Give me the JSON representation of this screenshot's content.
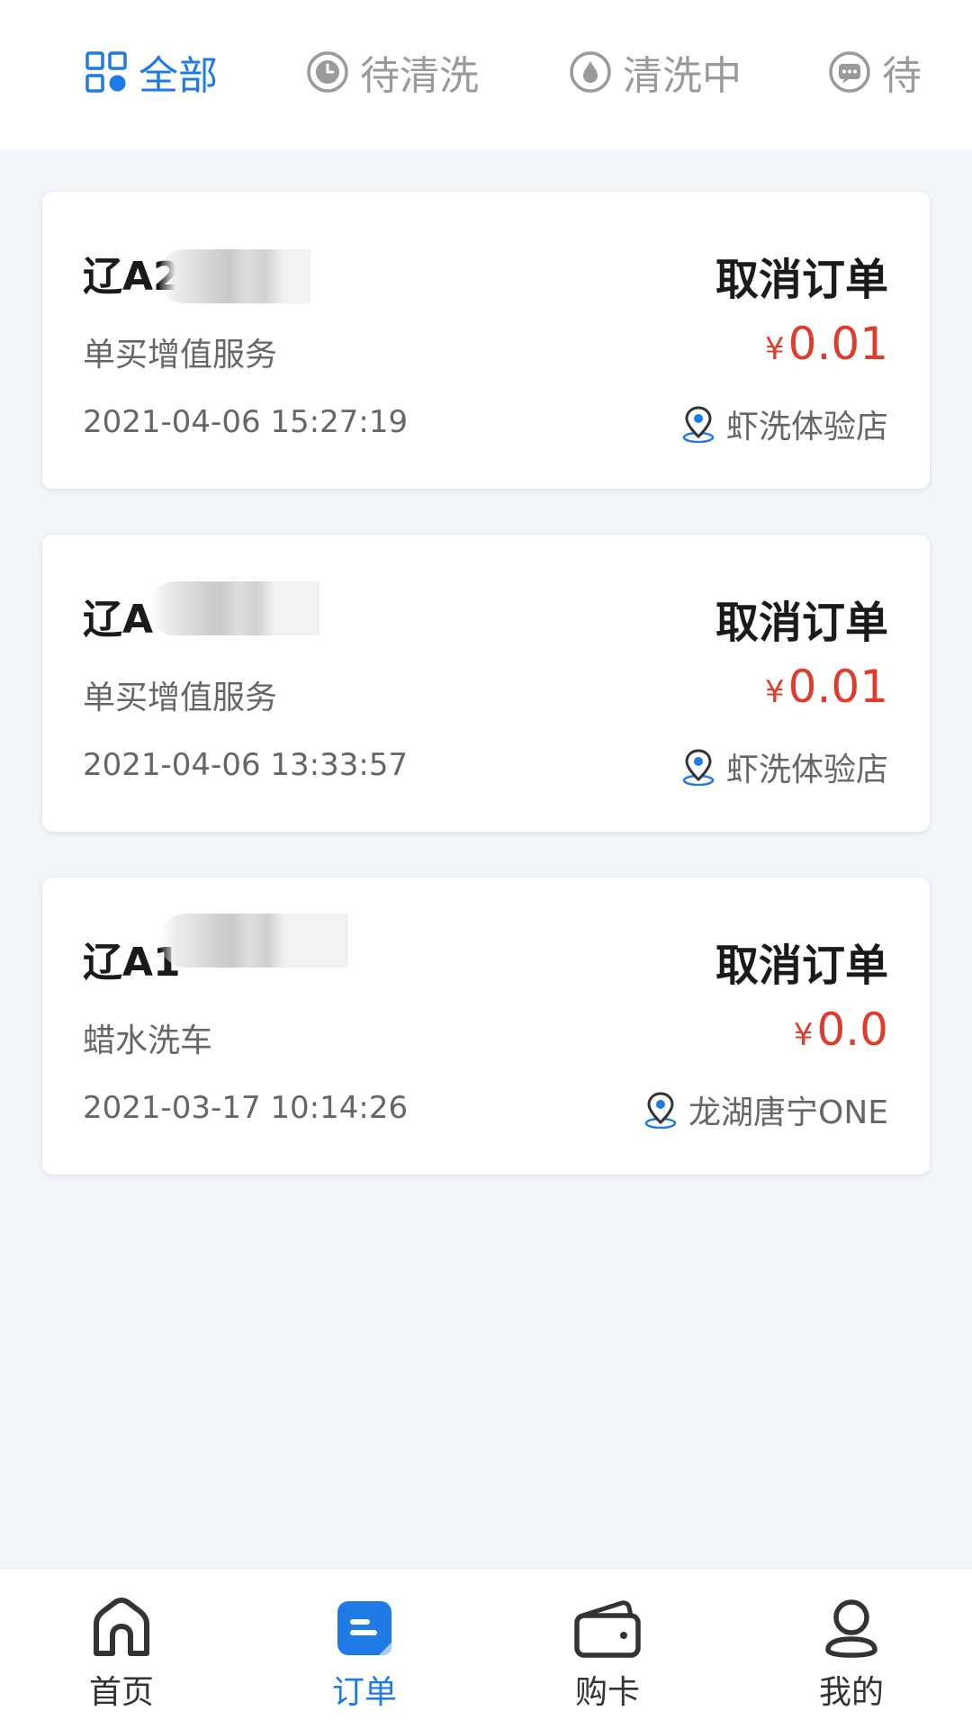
{
  "tabs": [
    {
      "label": "全部",
      "icon": "grid-icon",
      "active": true
    },
    {
      "label": "待清洗",
      "icon": "clock-icon",
      "active": false
    },
    {
      "label": "清洗中",
      "icon": "water-drop-icon",
      "active": false
    },
    {
      "label": "待",
      "icon": "chat-icon",
      "active": false
    }
  ],
  "orders": [
    {
      "plate": "辽A2",
      "service": "单买增值服务",
      "price_symbol": "¥",
      "price": "0.01",
      "time": "2021-04-06 15:27:19",
      "store": "虾洗体验店",
      "action": "取消订单"
    },
    {
      "plate": "辽A",
      "service": "单买增值服务",
      "price_symbol": "¥",
      "price": "0.01",
      "time": "2021-04-06 13:33:57",
      "store": "虾洗体验店",
      "action": "取消订单"
    },
    {
      "plate": "辽A1",
      "service": "蜡水洗车",
      "price_symbol": "¥",
      "price": "0.0",
      "time": "2021-03-17 10:14:26",
      "store": "龙湖唐宁ONE",
      "action": "取消订单"
    }
  ],
  "nav": [
    {
      "label": "首页",
      "icon": "home-icon",
      "active": false
    },
    {
      "label": "订单",
      "icon": "order-icon",
      "active": true
    },
    {
      "label": "购卡",
      "icon": "wallet-icon",
      "active": false
    },
    {
      "label": "我的",
      "icon": "user-icon",
      "active": false
    }
  ],
  "colors": {
    "accent": "#1e7be6",
    "price": "#e03c2e",
    "background": "#f2f5fa"
  }
}
